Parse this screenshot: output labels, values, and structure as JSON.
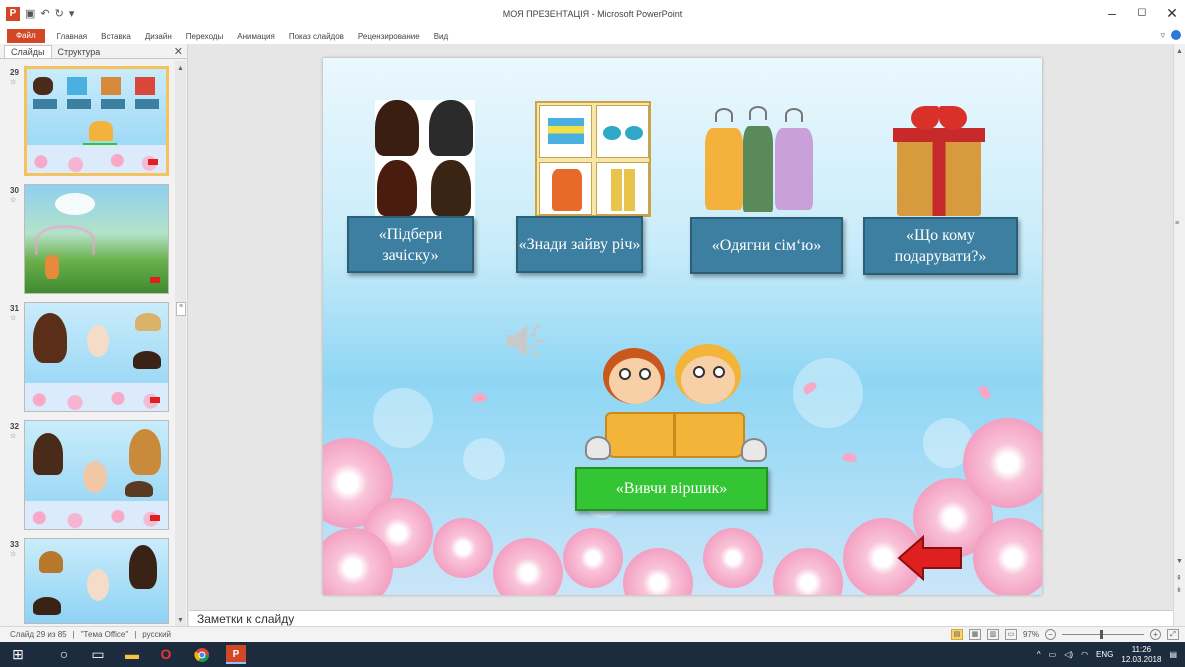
{
  "window": {
    "title": "МОЯ ПРЕЗЕНТАЦІЯ - Microsoft PowerPoint",
    "app_icon": "powerpoint-icon",
    "controls": [
      "–",
      "◻",
      "✕"
    ]
  },
  "ribbon": {
    "file_tab": "Файл",
    "tabs": [
      "Главная",
      "Вставка",
      "Дизайн",
      "Переходы",
      "Анимация",
      "Показ слайдов",
      "Рецензирование",
      "Вид"
    ]
  },
  "left_pane": {
    "tabs": [
      "Слайды",
      "Структура"
    ],
    "close": "✕",
    "thumbnails": [
      {
        "number": "29",
        "selected": true
      },
      {
        "number": "30",
        "selected": false
      },
      {
        "number": "31",
        "selected": false
      },
      {
        "number": "32",
        "selected": false
      },
      {
        "number": "33",
        "selected": false
      }
    ]
  },
  "slide": {
    "games": [
      "«Підбери зачіску»",
      "«Знади зайву річ»",
      "«Одягни сім‘ю»",
      "«Що кому подарувати?»"
    ],
    "poem_button": "«Вивчи віршик»",
    "sound_icon": "speaker-icon",
    "back_arrow": "arrow-left-icon"
  },
  "notes": {
    "placeholder": "Заметки к слайду"
  },
  "status": {
    "slide_info": "Слайд 29 из 85",
    "theme": "\"Тема Office\"",
    "language": "русский",
    "zoom": "97%"
  },
  "taskbar": {
    "lang": "ENG",
    "time": "11:26",
    "date": "12.03.2018"
  },
  "colors": {
    "accent": "#d24726",
    "card_blue": "#3d7fa0",
    "card_green": "#33c533",
    "taskbar": "#1c2b3d"
  }
}
